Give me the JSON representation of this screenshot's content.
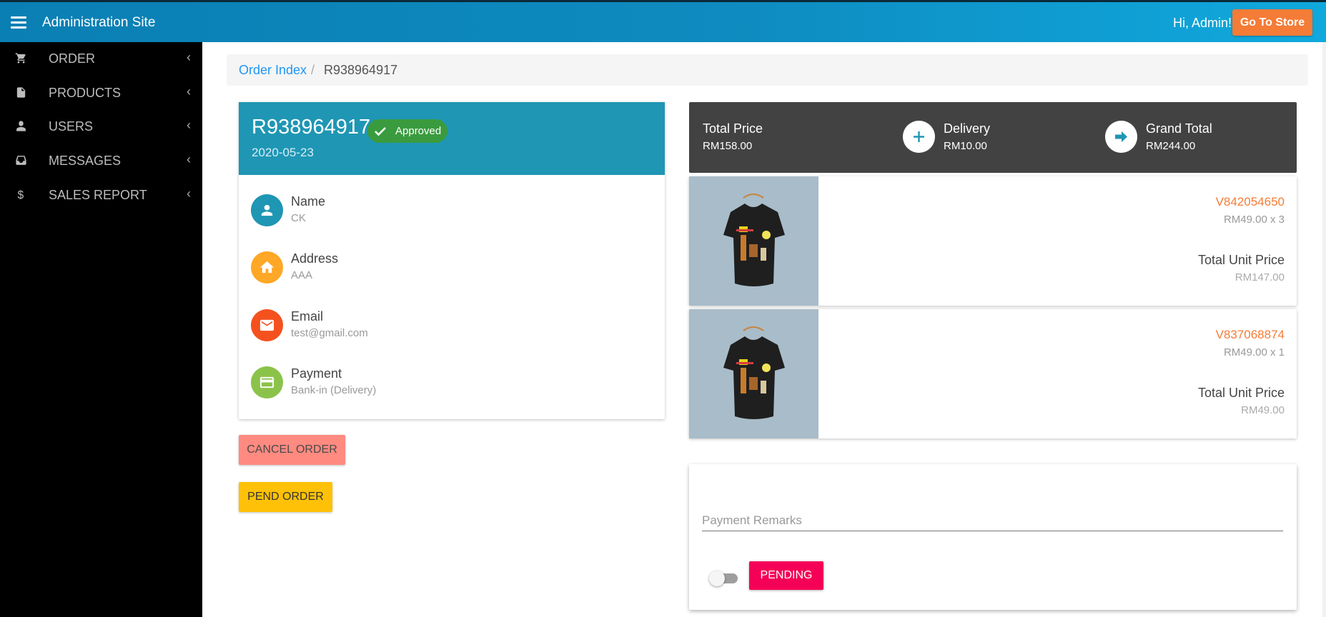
{
  "header": {
    "app_title": "Administration Site",
    "greeting": "Hi, Admin!",
    "store_button": "Go To Store",
    "accent": "#0e8bc0",
    "store_button_color": "#f47c37"
  },
  "sidebar": {
    "items": [
      {
        "label": "ORDER",
        "icon": "cart-icon"
      },
      {
        "label": "PRODUCTS",
        "icon": "file-icon"
      },
      {
        "label": "USERS",
        "icon": "user-icon"
      },
      {
        "label": "MESSAGES",
        "icon": "inbox-icon"
      },
      {
        "label": "SALES REPORT",
        "icon": "dollar-icon"
      }
    ],
    "chevron": "‹"
  },
  "breadcrumb": {
    "link": "Order Index",
    "separator": "/",
    "current": "R938964917"
  },
  "order": {
    "number": "R938964917",
    "status": "Approved",
    "date": "2020-05-23",
    "fields": [
      {
        "label": "Name",
        "value": "CK",
        "icon": "person-icon",
        "color": "#1f96b4"
      },
      {
        "label": "Address",
        "value": "AAA",
        "icon": "home-icon",
        "color": "#ffa726"
      },
      {
        "label": "Email",
        "value": "test@gmail.com",
        "icon": "mail-icon",
        "color": "#f4511e"
      },
      {
        "label": "Payment",
        "value": "Bank-in (Delivery)",
        "icon": "card-icon",
        "color": "#8bc34a"
      }
    ]
  },
  "actions": {
    "cancel": "CANCEL ORDER",
    "pend": "PEND ORDER"
  },
  "totals": {
    "total_price_label": "Total Price",
    "total_price": "RM158.00",
    "delivery_label": "Delivery",
    "delivery": "RM10.00",
    "grand_total_label": "Grand Total",
    "grand_total": "RM244.00"
  },
  "items": [
    {
      "code": "V842054650",
      "qty": "RM49.00 x 3",
      "total_label": "Total Unit Price",
      "total": "RM147.00"
    },
    {
      "code": "V837068874",
      "qty": "RM49.00 x 1",
      "total_label": "Total Unit Price",
      "total": "RM49.00"
    }
  ],
  "remarks": {
    "placeholder": "Payment Remarks",
    "toggle_on": false,
    "status_button": "PENDING"
  }
}
